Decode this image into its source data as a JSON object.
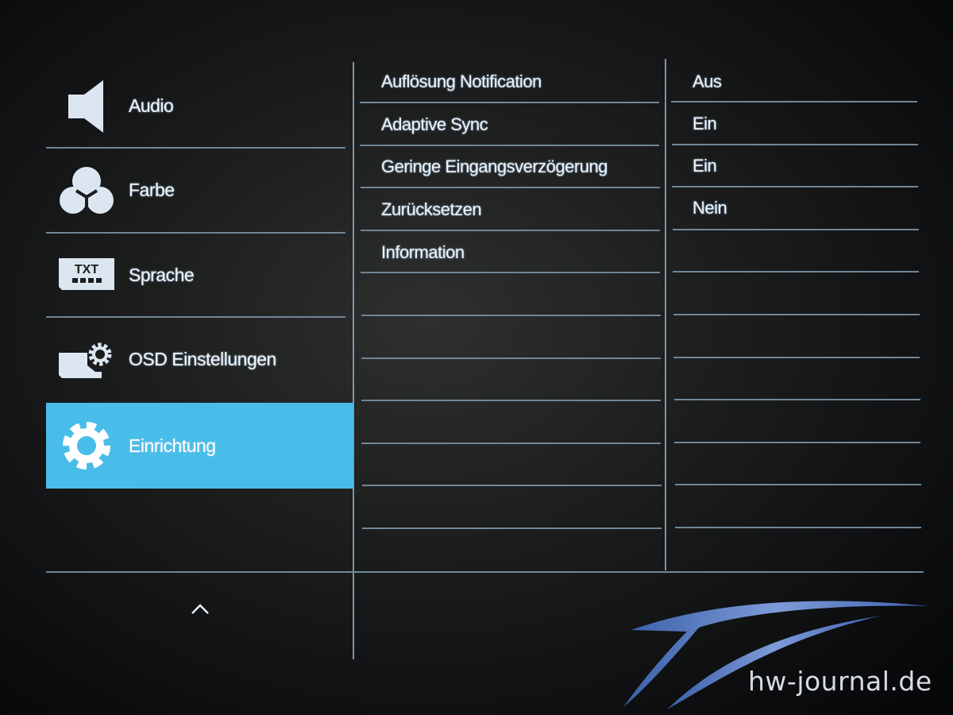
{
  "sidebar": {
    "items": [
      {
        "label": "Audio",
        "icon": "speaker-icon"
      },
      {
        "label": "Farbe",
        "icon": "color-circles-icon"
      },
      {
        "label": "Sprache",
        "icon": "txt-language-icon",
        "icon_text": "TXT"
      },
      {
        "label": "OSD Einstellungen",
        "icon": "osd-settings-icon"
      },
      {
        "label": "Einrichtung",
        "icon": "gear-icon",
        "selected": true
      }
    ],
    "scroll_up_icon": "chevron-up-icon"
  },
  "settings": {
    "rows": [
      {
        "label": "Auflösung Notification",
        "value": "Aus"
      },
      {
        "label": "Adaptive Sync",
        "value": "Ein"
      },
      {
        "label": "Geringe Eingangsverzögerung",
        "value": "Ein"
      },
      {
        "label": "Zurücksetzen",
        "value": "Nein"
      },
      {
        "label": "Information",
        "value": ""
      }
    ]
  },
  "colors": {
    "selected": "#49bde9",
    "lines": "#6f8798",
    "background": "#1c1d1d"
  },
  "watermark": {
    "text": "hw-journal.de"
  }
}
